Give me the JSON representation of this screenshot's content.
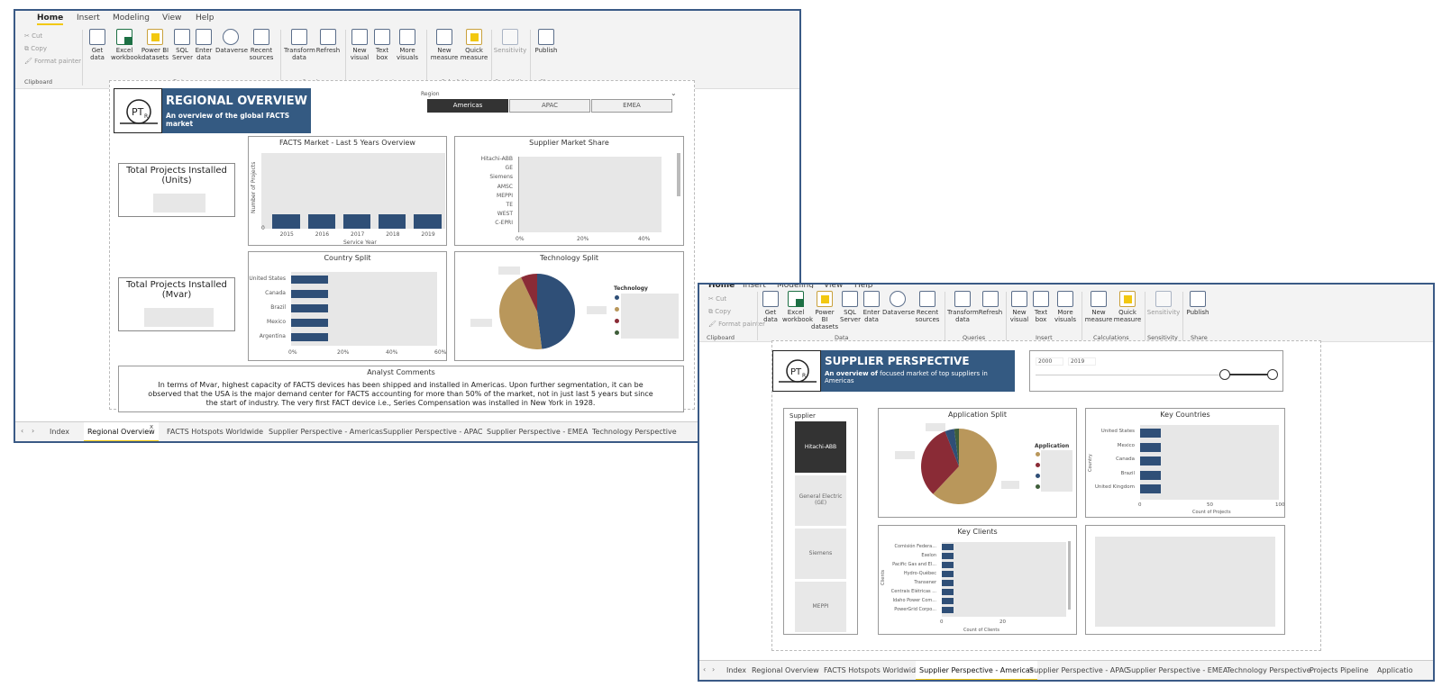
{
  "window1": {
    "menu": {
      "home": "Home",
      "insert": "Insert",
      "modeling": "Modeling",
      "view": "View",
      "help": "Help"
    },
    "clipboard": {
      "cut": "Cut",
      "copy": "Copy",
      "format_painter": "Format painter",
      "group": "Clipboard"
    },
    "ribbon": {
      "get_data": "Get data",
      "excel": "Excel workbook",
      "powerbi": "Power BI datasets",
      "sql": "SQL Server",
      "enter": "Enter data",
      "dataverse": "Dataverse",
      "recent": "Recent sources",
      "transform": "Transform data",
      "refresh": "Refresh",
      "new_visual": "New visual",
      "text_box": "Text box",
      "more_visuals": "More visuals",
      "new_measure": "New measure",
      "quick_measure": "Quick measure",
      "sensitivity": "Sensitivity",
      "publish": "Publish"
    },
    "groups": {
      "data": "Data",
      "queries": "Queries",
      "insert": "Insert",
      "calculations": "Calculations",
      "sensitivity": "Sensitivity",
      "share": "Share"
    },
    "report": {
      "logo_text": "PT",
      "logo_sub": "R",
      "title": "REGIONAL OVERVIEW",
      "subtitle": "An overview of the global FACTS market",
      "region_label": "Region",
      "regions": [
        "Americas",
        "APAC",
        "EMEA"
      ],
      "kpi1": "Total Projects Installed (Units)",
      "kpi2": "Total Projects Installed (Mvar)",
      "market_title": "FACTS Market - Last 5 Years Overview",
      "market_ylabel": "Number of Projects",
      "market_xlabel": "Service Year",
      "market_zero": "0",
      "share_title": "Supplier Market Share",
      "country_title": "Country Split",
      "tech_title": "Technology Split",
      "tech_legend": "Technology",
      "comments_title": "Analyst Comments",
      "comments": "In terms of Mvar, highest capacity of FACTS devices has been shipped and installed in Americas. Upon further segmentation, it can be observed that the USA is the major demand center for FACTS accounting for more than 50% of the market, not in just last 5 years but since the start of industry. The very first FACT device i.e., Series Compensation was installed in New York in 1928."
    },
    "tabs": [
      "Index",
      "Regional Overview",
      "FACTS Hotspots Worldwide",
      "Supplier Perspective - Americas",
      "Supplier Perspective - APAC",
      "Supplier Perspective - EMEA",
      "Technology Perspective"
    ],
    "close_glyph": "x"
  },
  "window2": {
    "menu": {
      "home": "Home",
      "insert": "Insert",
      "modeling": "Modeling",
      "view": "View",
      "help": "Help"
    },
    "report": {
      "logo_text": "PT",
      "logo_sub": "R",
      "title": "SUPPLIER PERSPECTIVE",
      "subtitle_bold": "An overview of",
      "subtitle_rest": "focused market of top suppliers in Americas",
      "slider_min": "2000",
      "slider_max": "2019",
      "supplier_label": "Supplier",
      "suppliers": [
        "Hitachi-ABB",
        "General Electric (GE)",
        "Siemens",
        "MEPPI"
      ],
      "app_title": "Application Split",
      "app_legend": "Application",
      "countries_title": "Key Countries",
      "countries_ylabel": "Country",
      "countries_xlabel": "Count of Projects",
      "clients_title": "Key Clients",
      "clients_ylabel": "Clients",
      "clients_xlabel": "Count of Clients"
    },
    "tabs": [
      "Index",
      "Regional Overview",
      "FACTS Hotspots Worldwide",
      "Supplier Perspective - Americas",
      "Supplier Perspective - APAC",
      "Supplier Perspective - EMEA",
      "Technology Perspective",
      "Projects Pipeline",
      "Applicatio"
    ]
  },
  "chart_data": [
    {
      "type": "bar",
      "title": "FACTS Market - Last 5 Years Overview",
      "xlabel": "Service Year",
      "ylabel": "Number of Projects",
      "categories": [
        "2015",
        "2016",
        "2017",
        "2018",
        "2019"
      ],
      "values": [
        1,
        1,
        1,
        1,
        1
      ],
      "value_note": "bar heights equal; values not labeled"
    },
    {
      "type": "bar",
      "title": "Supplier Market Share",
      "orientation": "horizontal",
      "categories": [
        "Hitachi-ABB",
        "GE",
        "Siemens",
        "AMSC",
        "MEPPI",
        "TE",
        "WEST",
        "C-EPRI"
      ],
      "xticks": [
        "0%",
        "20%",
        "40%"
      ]
    },
    {
      "type": "bar",
      "title": "Country Split",
      "orientation": "horizontal",
      "categories": [
        "United States",
        "Canada",
        "Brazil",
        "Mexico",
        "Argentina"
      ],
      "values": [
        0.015,
        0.015,
        0.015,
        0.015,
        0.015
      ],
      "xticks": [
        "0%",
        "20%",
        "40%",
        "60%"
      ]
    },
    {
      "type": "pie",
      "title": "Technology Split",
      "legend_title": "Technology",
      "colors": [
        "#2f4f77",
        "#b9975b",
        "#8a2b36",
        "#3f5e3a"
      ],
      "values": [
        48,
        45,
        7,
        0
      ]
    },
    {
      "type": "pie",
      "title": "Application Split",
      "legend_title": "Application",
      "colors": [
        "#b9975b",
        "#8a2b36",
        "#2f4f77",
        "#3f5e3a"
      ],
      "values": [
        62,
        32,
        4,
        2
      ]
    },
    {
      "type": "bar",
      "title": "Key Countries",
      "orientation": "horizontal",
      "ylabel": "Country",
      "xlabel": "Count of Projects",
      "categories": [
        "United States",
        "Mexico",
        "Canada",
        "Brazil",
        "United Kingdom"
      ],
      "values": [
        15,
        15,
        15,
        15,
        15
      ],
      "xticks": [
        "0",
        "50",
        "100"
      ]
    },
    {
      "type": "bar",
      "title": "Key Clients",
      "orientation": "horizontal",
      "ylabel": "Clients",
      "xlabel": "Count of Clients",
      "categories": [
        "Comisión Federa...",
        "Exelon",
        "Pacific Gas and El...",
        "Hydro-Québec",
        "Transener",
        "Centrais Elétricas ...",
        "Idaho Power Com...",
        "PowerGrid Corpo..."
      ],
      "values": [
        8,
        8,
        8,
        8,
        8,
        8,
        8,
        8
      ],
      "xticks": [
        "0",
        "20"
      ]
    }
  ]
}
